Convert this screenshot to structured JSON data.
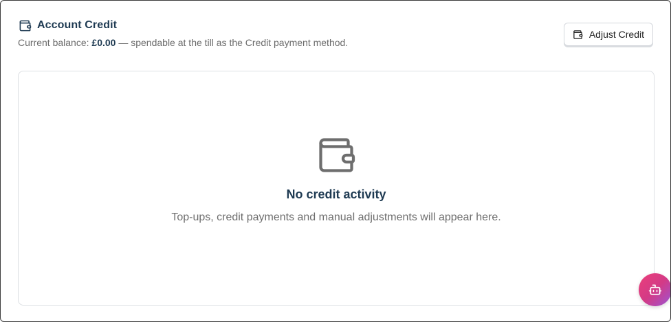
{
  "header": {
    "title": "Account Credit",
    "title_icon": "wallet-icon",
    "balance_prefix": "Current balance: ",
    "balance_amount": "£0.00",
    "balance_suffix": " — spendable at the till as the Credit payment method."
  },
  "actions": {
    "adjust_label": "Adjust Credit",
    "adjust_icon": "wallet-icon"
  },
  "empty_state": {
    "icon": "wallet-icon",
    "title": "No credit activity",
    "description": "Top-ups, credit payments and manual adjustments will appear here."
  },
  "assistant": {
    "icon": "bot-icon"
  },
  "colors": {
    "heading": "#1e3a52",
    "muted": "#6b6b6b",
    "border": "#dcdfe3",
    "fab_gradient_start": "#ec3f7a",
    "fab_gradient_end": "#9a55d6"
  }
}
